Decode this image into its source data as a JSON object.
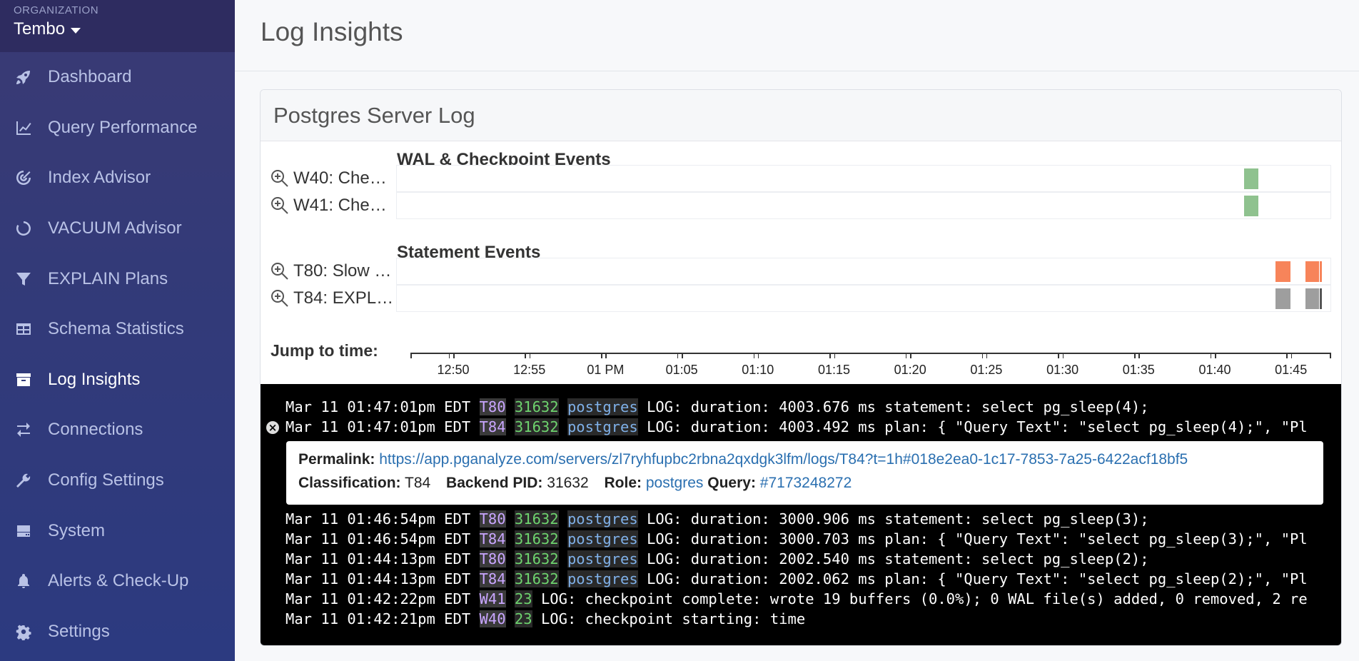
{
  "org": {
    "label": "ORGANIZATION",
    "name": "Tembo"
  },
  "sidebar": {
    "items": [
      {
        "label": "Dashboard",
        "icon": "rocket-icon"
      },
      {
        "label": "Query Performance",
        "icon": "line-chart-icon"
      },
      {
        "label": "Index Advisor",
        "icon": "target-icon"
      },
      {
        "label": "VACUUM Advisor",
        "icon": "spinner-icon"
      },
      {
        "label": "EXPLAIN Plans",
        "icon": "filter-icon"
      },
      {
        "label": "Schema Statistics",
        "icon": "table-icon"
      },
      {
        "label": "Log Insights",
        "icon": "archive-icon",
        "active": true
      },
      {
        "label": "Connections",
        "icon": "exchange-icon"
      },
      {
        "label": "Config Settings",
        "icon": "wrench-icon"
      },
      {
        "label": "System",
        "icon": "server-icon"
      },
      {
        "label": "Alerts & Check-Up",
        "icon": "bell-icon"
      },
      {
        "label": "Settings",
        "icon": "gear-icon"
      }
    ]
  },
  "page": {
    "title": "Log Insights"
  },
  "panel": {
    "title": "Postgres Server Log",
    "wal_section": "WAL & Checkpoint Events",
    "statement_section": "Statement Events",
    "wal_rows": [
      {
        "label": "W40: Che…"
      },
      {
        "label": "W41: Che…"
      }
    ],
    "statement_rows": [
      {
        "label": "T80: Slow …"
      },
      {
        "label": "T84: EXPL…"
      }
    ],
    "jump_label": "Jump to time:",
    "axis_ticks": [
      "12:50",
      "12:55",
      "01 PM",
      "01:05",
      "01:10",
      "01:15",
      "01:20",
      "01:25",
      "01:30",
      "01:35",
      "01:40",
      "01:45"
    ]
  },
  "colors": {
    "checkpoint": "#8fc28f",
    "slow": "#f7845a",
    "explain": "#9e9e9e"
  },
  "log": {
    "lines_top": [
      {
        "ts": "Mar 11 01:47:01pm EDT",
        "cls": "T80",
        "pid": "31632",
        "role": "postgres",
        "msg": "LOG: duration: 4003.676 ms statement: select pg_sleep(4);"
      },
      {
        "ts": "Mar 11 01:47:01pm EDT",
        "cls": "T84",
        "pid": "31632",
        "role": "postgres",
        "msg": "LOG: duration: 4003.492 ms plan: { \"Query Text\": \"select pg_sleep(4);\", \"Pl",
        "expanded": true
      }
    ],
    "detail": {
      "permalink_label": "Permalink:",
      "permalink": "https://app.pganalyze.com/servers/zl7ryhfupbc2rbna2qxdgk3lfm/logs/T84?t=1h#018e2ea0-1c17-7853-7a25-6422acf18bf5",
      "classification_label": "Classification:",
      "classification": "T84",
      "pid_label": "Backend PID:",
      "pid": "31632",
      "role_label": "Role:",
      "role": "postgres",
      "query_label": "Query:",
      "query": "#7173248272"
    },
    "lines_bottom": [
      {
        "ts": "Mar 11 01:46:54pm EDT",
        "cls": "T80",
        "pid": "31632",
        "role": "postgres",
        "msg": "LOG: duration: 3000.906 ms statement: select pg_sleep(3);"
      },
      {
        "ts": "Mar 11 01:46:54pm EDT",
        "cls": "T84",
        "pid": "31632",
        "role": "postgres",
        "msg": "LOG: duration: 3000.703 ms plan: { \"Query Text\": \"select pg_sleep(3);\", \"Pl"
      },
      {
        "ts": "Mar 11 01:44:13pm EDT",
        "cls": "T80",
        "pid": "31632",
        "role": "postgres",
        "msg": "LOG: duration: 2002.540 ms statement: select pg_sleep(2);"
      },
      {
        "ts": "Mar 11 01:44:13pm EDT",
        "cls": "T84",
        "pid": "31632",
        "role": "postgres",
        "msg": "LOG: duration: 2002.062 ms plan: { \"Query Text\": \"select pg_sleep(2);\", \"Pl"
      },
      {
        "ts": "Mar 11 01:42:22pm EDT",
        "cls": "W41",
        "pid": "23",
        "msg": "LOG: checkpoint complete: wrote 19 buffers (0.0%); 0 WAL file(s) added, 0 removed, 2 re"
      },
      {
        "ts": "Mar 11 01:42:21pm EDT",
        "cls": "W40",
        "pid": "23",
        "msg": "LOG: checkpoint starting: time"
      }
    ]
  }
}
